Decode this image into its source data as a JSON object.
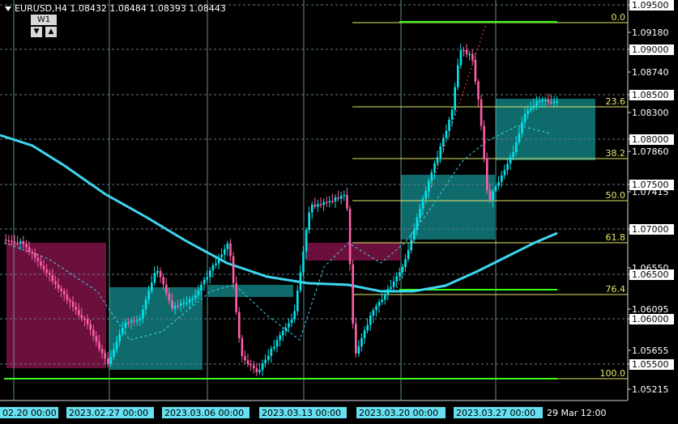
{
  "header": {
    "symbol_line": "EURUSD,H4  1.08432 1.08484 1.08393 1.08443",
    "timeframe_button": "W1",
    "arrow_down": "▼",
    "arrow_up": "▲"
  },
  "price_axis": {
    "labels": [
      {
        "text": "1.09500",
        "boxed": true
      },
      {
        "text": "1.09180",
        "boxed": false
      },
      {
        "text": "1.09000",
        "boxed": true
      },
      {
        "text": "1.08740",
        "boxed": false
      },
      {
        "text": "1.08500",
        "boxed": true
      },
      {
        "text": "1.08300",
        "boxed": false
      },
      {
        "text": "1.08000",
        "boxed": true
      },
      {
        "text": "1.07860",
        "boxed": false
      },
      {
        "text": "1.07500",
        "boxed": true
      },
      {
        "text": "1.07415",
        "boxed": false
      },
      {
        "text": "1.07000",
        "boxed": true
      },
      {
        "text": "1.06550",
        "boxed": false
      },
      {
        "text": "1.06500",
        "boxed": true
      },
      {
        "text": "1.06095",
        "boxed": false
      },
      {
        "text": "1.06000",
        "boxed": true
      },
      {
        "text": "1.05655",
        "boxed": false
      },
      {
        "text": "1.05500",
        "boxed": true
      },
      {
        "text": "1.05215",
        "boxed": false
      }
    ]
  },
  "time_axis": {
    "labels": [
      {
        "text": "02.20 00:00",
        "boxed": true
      },
      {
        "text": "2023.02.27 00:00",
        "boxed": true
      },
      {
        "text": "2023.03.06 00:00",
        "boxed": true
      },
      {
        "text": "2023.03.13 00:00",
        "boxed": true
      },
      {
        "text": "2023.03.20 00:00",
        "boxed": true
      },
      {
        "text": "2023.03.27 00:00",
        "boxed": true
      },
      {
        "text": "29 Mar 12:00",
        "boxed": false
      }
    ]
  },
  "fibonacci": {
    "levels": [
      "0.0",
      "23.6",
      "38.2",
      "50.0",
      "61.8",
      "76.4",
      "100.0"
    ]
  },
  "colors": {
    "background": "#000000",
    "bull": "#00e5ee",
    "bear": "#ff5ea8",
    "ma": "#3dd6f0",
    "fib": "#e6e66a",
    "green_line": "#39ff14",
    "supply_zone": "#6b0f3c",
    "demand_zone": "#0f6b6b",
    "gridline": "#6a7a8a",
    "time_box": "#66e0f0",
    "price_box": "#ffffff"
  }
}
